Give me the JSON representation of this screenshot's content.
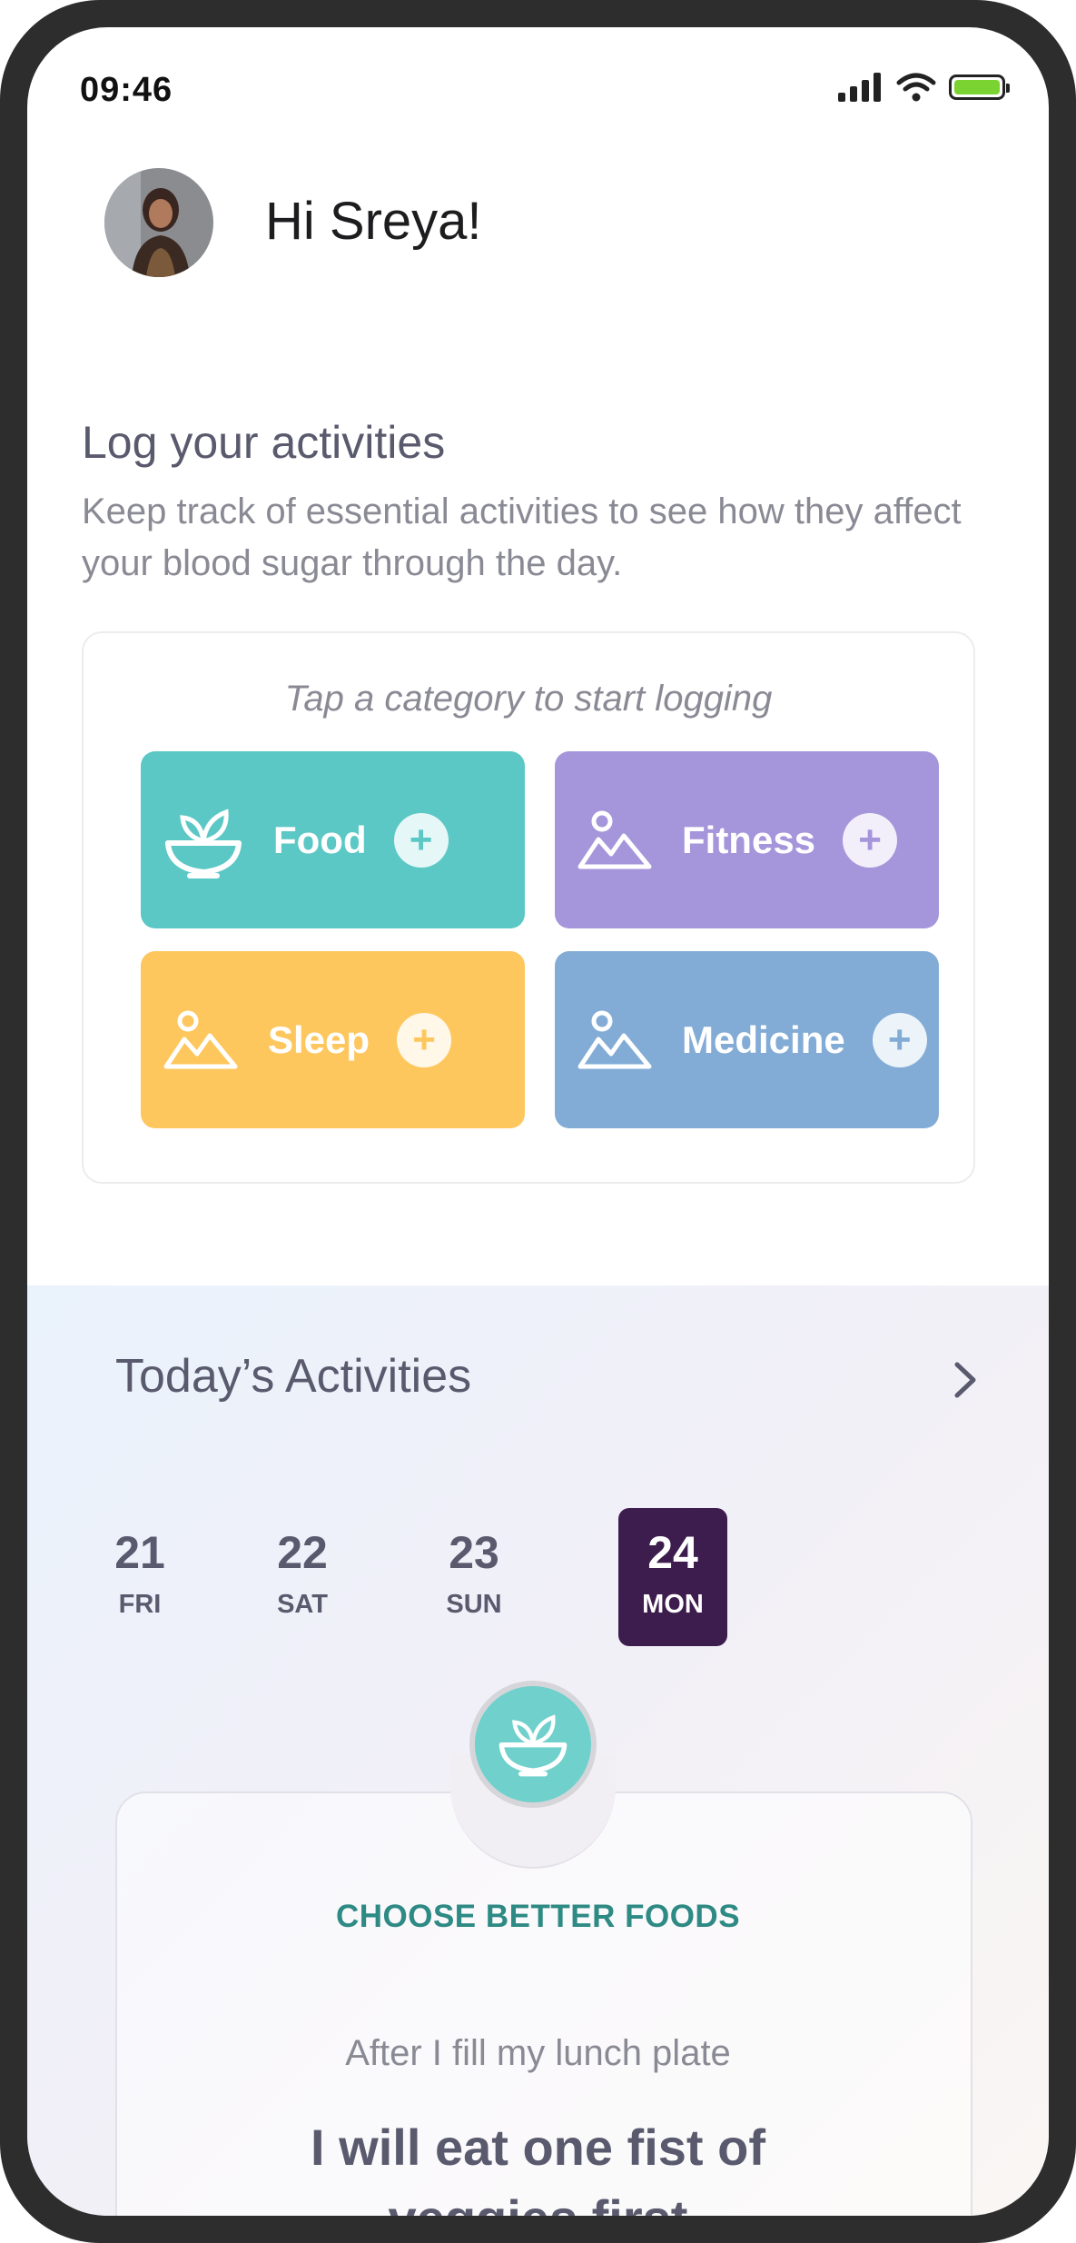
{
  "status_bar": {
    "time": "09:46",
    "battery_color": "#7bd332"
  },
  "greeting": {
    "text": "Hi Sreya!"
  },
  "log": {
    "title": "Log your activities",
    "subtitle": "Keep track of essential activities to see how they affect your blood sugar through the day.",
    "hint": "Tap a category to start logging",
    "categories": [
      {
        "label": "Food",
        "color": "#5bc8c5",
        "icon": "bowl-icon",
        "plus": "+"
      },
      {
        "label": "Fitness",
        "color": "#a595da",
        "icon": "landscape-icon",
        "plus": "+"
      },
      {
        "label": "Sleep",
        "color": "#fec75e",
        "icon": "landscape-icon",
        "plus": "+"
      },
      {
        "label": "Medicine",
        "color": "#82acd6",
        "icon": "landscape-icon",
        "plus": "+"
      }
    ]
  },
  "today": {
    "title": "Today’s Activities",
    "days": [
      {
        "num": "21",
        "dow": "FRI",
        "selected": false
      },
      {
        "num": "22",
        "dow": "SAT",
        "selected": false
      },
      {
        "num": "23",
        "dow": "SUN",
        "selected": false
      },
      {
        "num": "24",
        "dow": "MON",
        "selected": true
      }
    ],
    "selected_color": "#3d1c4e"
  },
  "goal": {
    "heading": "CHOOSE BETTER FOODS",
    "cue": "After I fill my lunch plate",
    "text": "I will eat one fist of veggies first",
    "accent": "#2e8a84"
  }
}
